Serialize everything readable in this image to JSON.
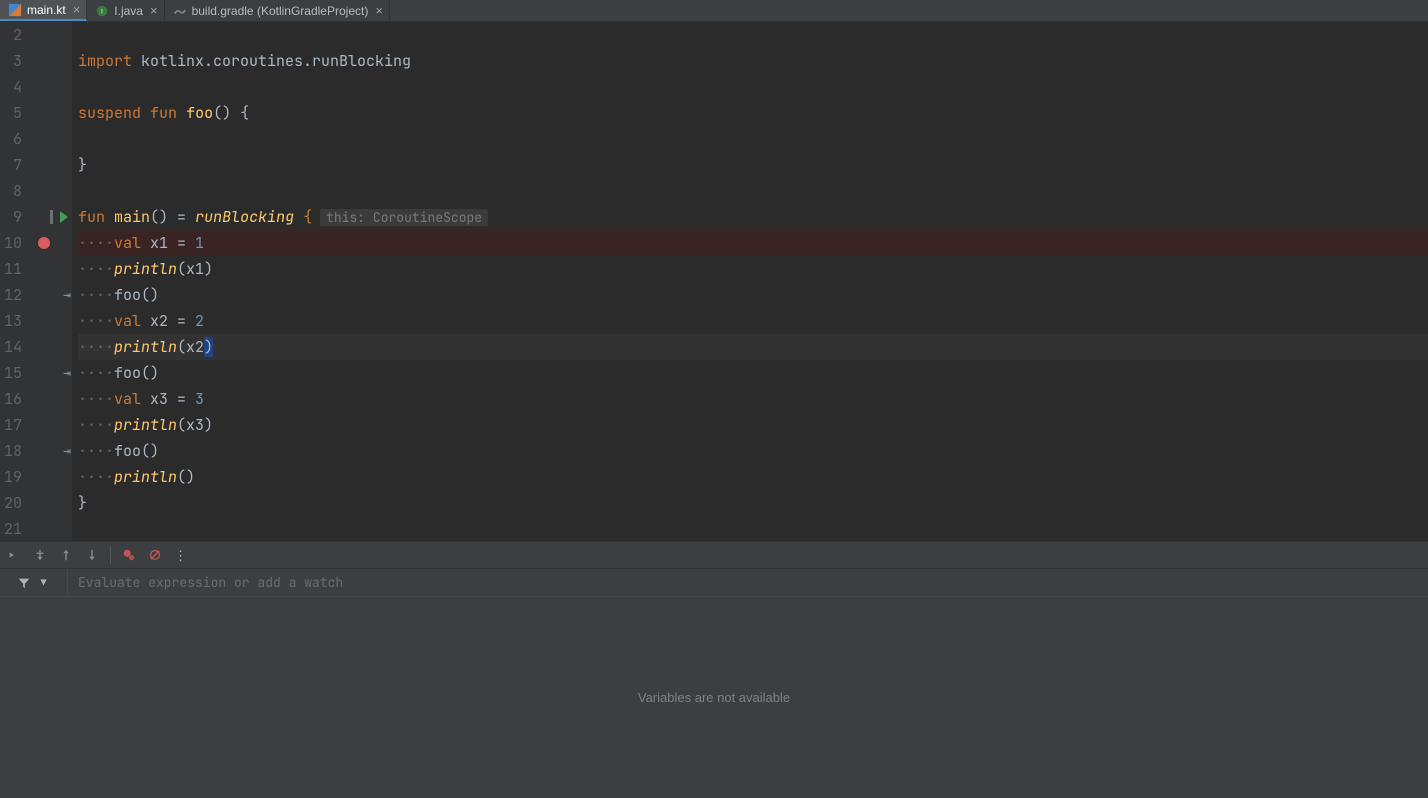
{
  "tabs": [
    {
      "name": "main.kt",
      "icon": "kotlin",
      "active": true
    },
    {
      "name": "I.java",
      "icon": "java",
      "active": false
    },
    {
      "name": "build.gradle (KotlinGradleProject)",
      "icon": "gradle",
      "active": false
    }
  ],
  "gutter": {
    "run_marker_line": 9,
    "breakpoint_line": 10,
    "suspend_lines": [
      12,
      15,
      18
    ],
    "current_line": 14
  },
  "code": {
    "lines": [
      {
        "n": 2,
        "tokens": []
      },
      {
        "n": 3,
        "tokens": [
          [
            "kw",
            "import"
          ],
          [
            "",
            " kotlinx.coroutines.runBlocking"
          ]
        ]
      },
      {
        "n": 4,
        "tokens": []
      },
      {
        "n": 5,
        "tokens": [
          [
            "kw",
            "suspend"
          ],
          [
            "",
            " "
          ],
          [
            "kw",
            "fun"
          ],
          [
            "",
            " "
          ],
          [
            "fnname",
            "foo"
          ],
          [
            "",
            "() {"
          ]
        ]
      },
      {
        "n": 6,
        "tokens": []
      },
      {
        "n": 7,
        "tokens": [
          [
            "",
            "}"
          ]
        ]
      },
      {
        "n": 8,
        "tokens": []
      },
      {
        "n": 9,
        "tokens": [
          [
            "kw",
            "fun"
          ],
          [
            "",
            " "
          ],
          [
            "fnname",
            "main"
          ],
          [
            "",
            "() = "
          ],
          [
            "fn",
            "runBlocking"
          ],
          [
            "",
            " "
          ],
          [
            "kw",
            "{"
          ]
        ],
        "hint": "this: CoroutineScope"
      },
      {
        "n": 10,
        "tokens": [
          [
            "dot",
            "····"
          ],
          [
            "kw",
            "val"
          ],
          [
            "",
            " x1 = "
          ],
          [
            "num",
            "1"
          ]
        ],
        "bp": true
      },
      {
        "n": 11,
        "tokens": [
          [
            "dot",
            "····"
          ],
          [
            "fn",
            "println"
          ],
          [
            "",
            "(x1)"
          ]
        ]
      },
      {
        "n": 12,
        "tokens": [
          [
            "dot",
            "····"
          ],
          [
            "",
            "foo()"
          ]
        ]
      },
      {
        "n": 13,
        "tokens": [
          [
            "dot",
            "····"
          ],
          [
            "kw",
            "val"
          ],
          [
            "",
            " x2 = "
          ],
          [
            "num",
            "2"
          ]
        ]
      },
      {
        "n": 14,
        "tokens": [
          [
            "dot",
            "····"
          ],
          [
            "fn",
            "println"
          ],
          [
            "",
            "(x2"
          ],
          [
            "caret",
            ")"
          ]
        ],
        "current": true
      },
      {
        "n": 15,
        "tokens": [
          [
            "dot",
            "····"
          ],
          [
            "",
            "foo()"
          ]
        ]
      },
      {
        "n": 16,
        "tokens": [
          [
            "dot",
            "····"
          ],
          [
            "kw",
            "val"
          ],
          [
            "",
            " x3 = "
          ],
          [
            "num",
            "3"
          ]
        ]
      },
      {
        "n": 17,
        "tokens": [
          [
            "dot",
            "····"
          ],
          [
            "fn",
            "println"
          ],
          [
            "",
            "(x3)"
          ]
        ]
      },
      {
        "n": 18,
        "tokens": [
          [
            "dot",
            "····"
          ],
          [
            "",
            "foo()"
          ]
        ]
      },
      {
        "n": 19,
        "tokens": [
          [
            "dot",
            "····"
          ],
          [
            "fn",
            "println"
          ],
          [
            "",
            "()"
          ]
        ]
      },
      {
        "n": 20,
        "tokens": [
          [
            "",
            "}"
          ]
        ]
      },
      {
        "n": 21,
        "tokens": []
      }
    ]
  },
  "watch": {
    "placeholder": "Evaluate expression or add a watch"
  },
  "variables_panel": {
    "empty_text": "Variables are not available"
  }
}
